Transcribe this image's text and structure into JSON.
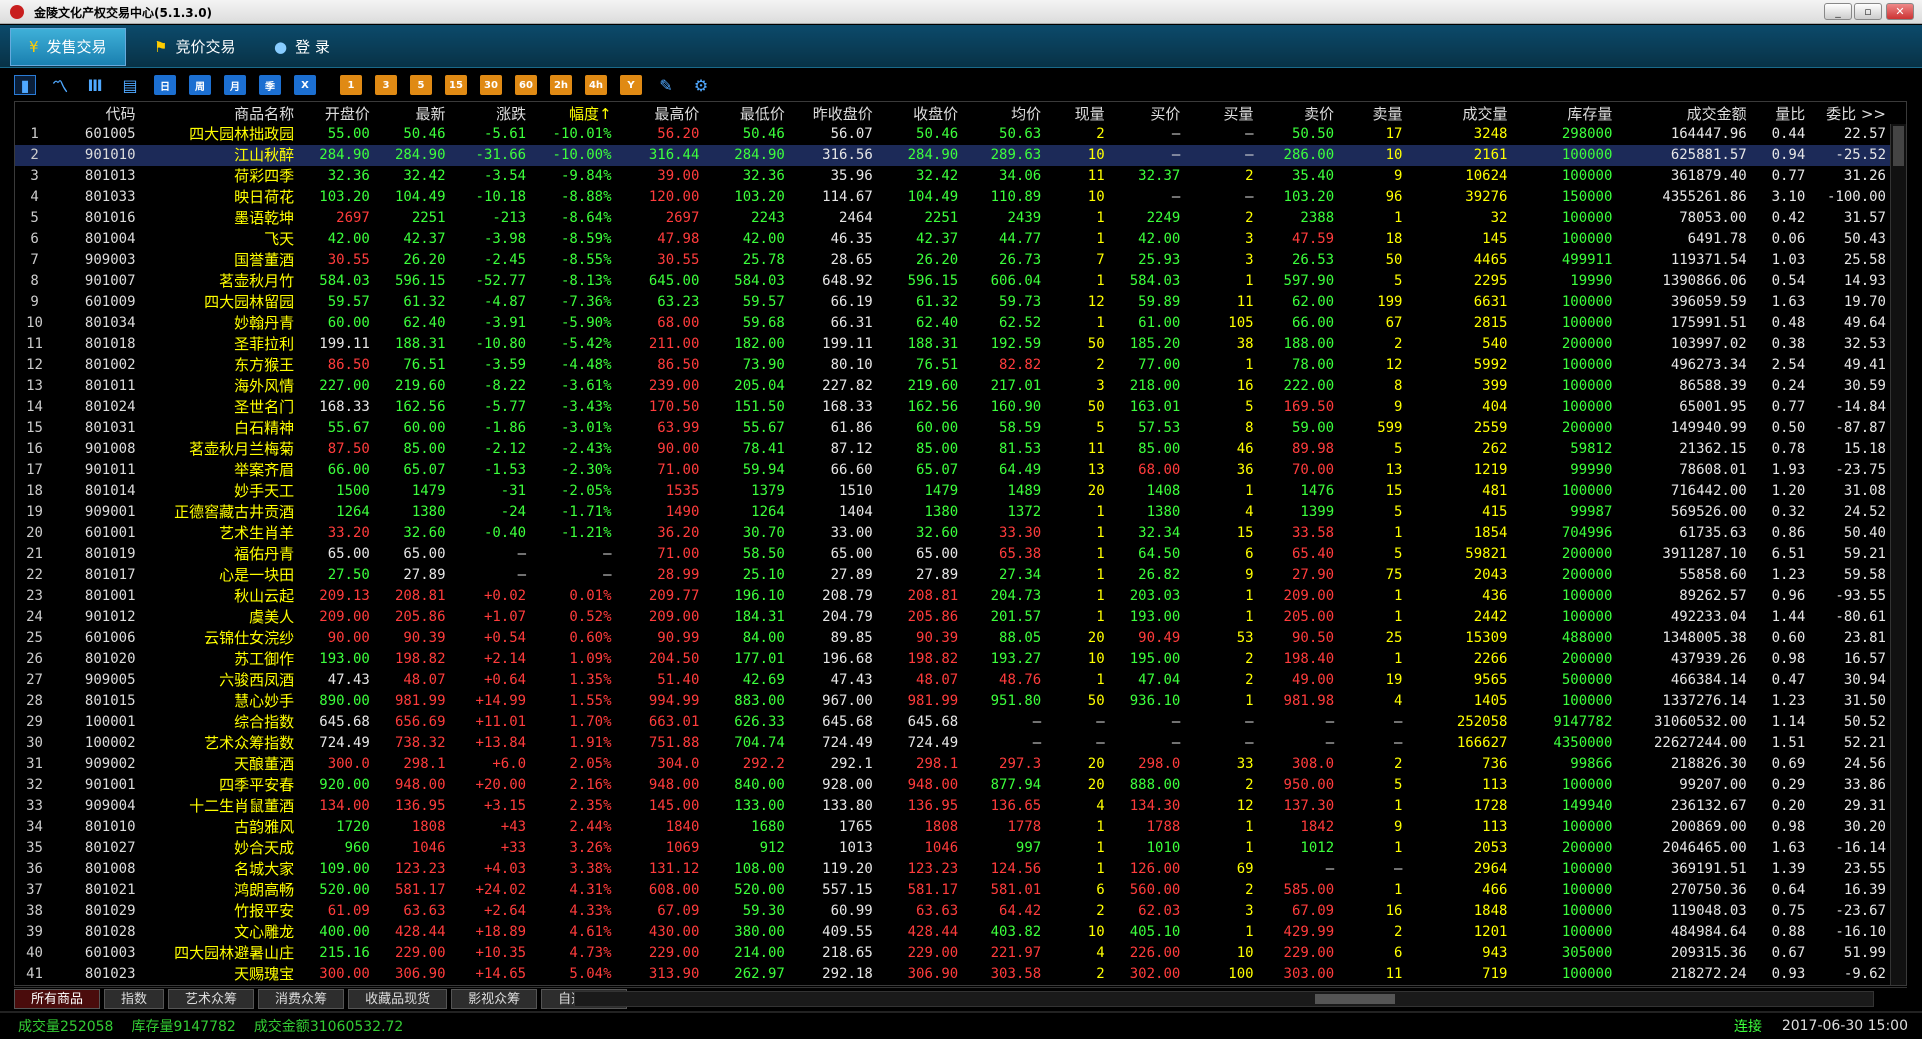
{
  "window": {
    "title": "金陵文化产权交易中心(5.1.3.0)",
    "min": "_",
    "max": "▫",
    "close": "✕"
  },
  "nav": {
    "tabs": [
      {
        "icon": "¥",
        "label": "发售交易",
        "active": true
      },
      {
        "icon": "⚑",
        "label": "竞价交易",
        "active": false
      },
      {
        "icon": "●",
        "label": "登  录",
        "active": false
      }
    ]
  },
  "toolbar": {
    "buttons": [
      {
        "icon": "bar-chart-icon",
        "glyph": "▮",
        "style": "ch sel"
      },
      {
        "icon": "line-chart-icon",
        "glyph": "〽",
        "style": "ch"
      },
      {
        "icon": "candlestick-icon",
        "glyph": "Ⅲ",
        "style": "ch"
      },
      {
        "icon": "calendar-icon",
        "glyph": "▤",
        "style": "ch"
      },
      {
        "label": "日",
        "style": "blue"
      },
      {
        "label": "周",
        "style": "blue"
      },
      {
        "label": "月",
        "style": "blue"
      },
      {
        "label": "季",
        "style": "blue"
      },
      {
        "label": "X",
        "style": "blue"
      },
      {
        "label": "1",
        "style": "orange"
      },
      {
        "label": "3",
        "style": "orange"
      },
      {
        "label": "5",
        "style": "orange"
      },
      {
        "label": "15",
        "style": "orange"
      },
      {
        "label": "30",
        "style": "orange"
      },
      {
        "label": "60",
        "style": "orange"
      },
      {
        "label": "2h",
        "style": "orange"
      },
      {
        "label": "4h",
        "style": "orange"
      },
      {
        "label": "Y",
        "style": "orange"
      },
      {
        "icon": "draw-tool-icon",
        "glyph": "✎",
        "style": "ch"
      },
      {
        "icon": "gear-icon",
        "glyph": "⚙",
        "style": "ch"
      }
    ]
  },
  "table": {
    "headers": [
      "",
      "代码",
      "商品名称",
      "开盘价",
      "最新",
      "涨跌",
      "幅度↑",
      "最高价",
      "最低价",
      "昨收盘价",
      "收盘价",
      "均价",
      "现量",
      "买价",
      "买量",
      "卖价",
      "卖量",
      "成交量",
      "库存量",
      "成交金额",
      "量比",
      "委比 >>"
    ],
    "rows": [
      [
        "1",
        "601005",
        "四大园林拙政园",
        "55.00",
        "50.46",
        "-5.61",
        "-10.01%",
        "56.20",
        "50.46",
        "56.07",
        "50.46",
        "50.63",
        "2",
        "—",
        "—",
        "50.50",
        "17",
        "3248",
        "298000",
        "164447.96",
        "0.44",
        "22.57"
      ],
      [
        "2",
        "901010",
        "江山秋醉",
        "284.90",
        "284.90",
        "-31.66",
        "-10.00%",
        "316.44",
        "284.90",
        "316.56",
        "284.90",
        "289.63",
        "10",
        "—",
        "—",
        "286.00",
        "10",
        "2161",
        "100000",
        "625881.57",
        "0.94",
        "-25.52"
      ],
      [
        "3",
        "801013",
        "荷彩四季",
        "32.36",
        "32.42",
        "-3.54",
        "-9.84%",
        "39.00",
        "32.36",
        "35.96",
        "32.42",
        "34.06",
        "11",
        "32.37",
        "2",
        "35.40",
        "9",
        "10624",
        "100000",
        "361879.40",
        "0.77",
        "31.26"
      ],
      [
        "4",
        "801033",
        "映日荷花",
        "103.20",
        "104.49",
        "-10.18",
        "-8.88%",
        "120.00",
        "103.20",
        "114.67",
        "104.49",
        "110.89",
        "10",
        "—",
        "—",
        "103.20",
        "96",
        "39276",
        "150000",
        "4355261.86",
        "3.10",
        "-100.00"
      ],
      [
        "5",
        "801016",
        "墨语乾坤",
        "2697",
        "2251",
        "-213",
        "-8.64%",
        "2697",
        "2243",
        "2464",
        "2251",
        "2439",
        "1",
        "2249",
        "2",
        "2388",
        "1",
        "32",
        "100000",
        "78053.00",
        "0.42",
        "31.57"
      ],
      [
        "6",
        "801004",
        "飞天",
        "42.00",
        "42.37",
        "-3.98",
        "-8.59%",
        "47.98",
        "42.00",
        "46.35",
        "42.37",
        "44.77",
        "1",
        "42.00",
        "3",
        "47.59",
        "18",
        "145",
        "100000",
        "6491.78",
        "0.06",
        "50.43"
      ],
      [
        "7",
        "909003",
        "国誉董酒",
        "30.55",
        "26.20",
        "-2.45",
        "-8.55%",
        "30.55",
        "25.78",
        "28.65",
        "26.20",
        "26.73",
        "7",
        "25.93",
        "3",
        "26.53",
        "50",
        "4465",
        "499911",
        "119371.54",
        "1.03",
        "25.58"
      ],
      [
        "8",
        "901007",
        "茗壶秋月竹",
        "584.03",
        "596.15",
        "-52.77",
        "-8.13%",
        "645.00",
        "584.03",
        "648.92",
        "596.15",
        "606.04",
        "1",
        "584.03",
        "1",
        "597.90",
        "5",
        "2295",
        "19990",
        "1390866.06",
        "0.54",
        "14.93"
      ],
      [
        "9",
        "601009",
        "四大园林留园",
        "59.57",
        "61.32",
        "-4.87",
        "-7.36%",
        "63.23",
        "59.57",
        "66.19",
        "61.32",
        "59.73",
        "12",
        "59.89",
        "11",
        "62.00",
        "199",
        "6631",
        "100000",
        "396059.59",
        "1.63",
        "19.70"
      ],
      [
        "10",
        "801034",
        "妙翰丹青",
        "60.00",
        "62.40",
        "-3.91",
        "-5.90%",
        "68.00",
        "59.68",
        "66.31",
        "62.40",
        "62.52",
        "1",
        "61.00",
        "105",
        "66.00",
        "67",
        "2815",
        "100000",
        "175991.51",
        "0.48",
        "49.64"
      ],
      [
        "11",
        "801018",
        "圣菲拉利",
        "199.11",
        "188.31",
        "-10.80",
        "-5.42%",
        "211.00",
        "182.00",
        "199.11",
        "188.31",
        "192.59",
        "50",
        "185.20",
        "38",
        "188.00",
        "2",
        "540",
        "200000",
        "103997.02",
        "0.38",
        "32.53"
      ],
      [
        "12",
        "801002",
        "东方猴王",
        "86.50",
        "76.51",
        "-3.59",
        "-4.48%",
        "86.50",
        "73.90",
        "80.10",
        "76.51",
        "82.82",
        "2",
        "77.00",
        "1",
        "78.00",
        "12",
        "5992",
        "100000",
        "496273.34",
        "2.54",
        "49.41"
      ],
      [
        "13",
        "801011",
        "海外风情",
        "227.00",
        "219.60",
        "-8.22",
        "-3.61%",
        "239.00",
        "205.04",
        "227.82",
        "219.60",
        "217.01",
        "3",
        "218.00",
        "16",
        "222.00",
        "8",
        "399",
        "100000",
        "86588.39",
        "0.24",
        "30.59"
      ],
      [
        "14",
        "801024",
        "圣世名门",
        "168.33",
        "162.56",
        "-5.77",
        "-3.43%",
        "170.50",
        "151.50",
        "168.33",
        "162.56",
        "160.90",
        "50",
        "163.01",
        "5",
        "169.50",
        "9",
        "404",
        "100000",
        "65001.95",
        "0.77",
        "-14.84"
      ],
      [
        "15",
        "801031",
        "白石精神",
        "55.67",
        "60.00",
        "-1.86",
        "-3.01%",
        "63.99",
        "55.67",
        "61.86",
        "60.00",
        "58.59",
        "5",
        "57.53",
        "8",
        "59.00",
        "599",
        "2559",
        "200000",
        "149940.99",
        "0.50",
        "-87.87"
      ],
      [
        "16",
        "901008",
        "茗壶秋月兰梅菊",
        "87.50",
        "85.00",
        "-2.12",
        "-2.43%",
        "90.00",
        "78.41",
        "87.12",
        "85.00",
        "81.53",
        "11",
        "85.00",
        "46",
        "89.98",
        "5",
        "262",
        "59812",
        "21362.15",
        "0.78",
        "15.18"
      ],
      [
        "17",
        "901011",
        "举案齐眉",
        "66.00",
        "65.07",
        "-1.53",
        "-2.30%",
        "71.00",
        "59.94",
        "66.60",
        "65.07",
        "64.49",
        "13",
        "68.00",
        "36",
        "70.00",
        "13",
        "1219",
        "99990",
        "78608.01",
        "1.93",
        "-23.75"
      ],
      [
        "18",
        "801014",
        "妙手天工",
        "1500",
        "1479",
        "-31",
        "-2.05%",
        "1535",
        "1379",
        "1510",
        "1479",
        "1489",
        "20",
        "1408",
        "1",
        "1476",
        "15",
        "481",
        "100000",
        "716442.00",
        "1.20",
        "31.08"
      ],
      [
        "19",
        "909001",
        "正德窖藏古井贡酒",
        "1264",
        "1380",
        "-24",
        "-1.71%",
        "1490",
        "1264",
        "1404",
        "1380",
        "1372",
        "1",
        "1380",
        "4",
        "1399",
        "5",
        "415",
        "99987",
        "569526.00",
        "0.32",
        "24.52"
      ],
      [
        "20",
        "601001",
        "艺术生肖羊",
        "33.20",
        "32.60",
        "-0.40",
        "-1.21%",
        "36.20",
        "30.70",
        "33.00",
        "32.60",
        "33.30",
        "1",
        "32.34",
        "15",
        "33.58",
        "1",
        "1854",
        "704996",
        "61735.63",
        "0.86",
        "50.40"
      ],
      [
        "21",
        "801019",
        "福佑丹青",
        "65.00",
        "65.00",
        "—",
        "—",
        "71.00",
        "58.50",
        "65.00",
        "65.00",
        "65.38",
        "1",
        "64.50",
        "6",
        "65.40",
        "5",
        "59821",
        "200000",
        "3911287.10",
        "6.51",
        "59.21"
      ],
      [
        "22",
        "801017",
        "心是一块田",
        "27.50",
        "27.89",
        "—",
        "—",
        "28.99",
        "25.10",
        "27.89",
        "27.89",
        "27.34",
        "1",
        "26.82",
        "9",
        "27.90",
        "75",
        "2043",
        "200000",
        "55858.60",
        "1.23",
        "59.58"
      ],
      [
        "23",
        "801001",
        "秋山云起",
        "209.13",
        "208.81",
        "+0.02",
        "0.01%",
        "209.77",
        "196.10",
        "208.79",
        "208.81",
        "204.73",
        "1",
        "203.03",
        "1",
        "209.00",
        "1",
        "436",
        "100000",
        "89262.57",
        "0.96",
        "-93.55"
      ],
      [
        "24",
        "901012",
        "虞美人",
        "209.00",
        "205.86",
        "+1.07",
        "0.52%",
        "209.00",
        "184.31",
        "204.79",
        "205.86",
        "201.57",
        "1",
        "193.00",
        "1",
        "205.00",
        "1",
        "2442",
        "100000",
        "492233.04",
        "1.44",
        "-80.61"
      ],
      [
        "25",
        "601006",
        "云锦仕女浣纱",
        "90.00",
        "90.39",
        "+0.54",
        "0.60%",
        "90.99",
        "84.00",
        "89.85",
        "90.39",
        "88.05",
        "20",
        "90.49",
        "53",
        "90.50",
        "25",
        "15309",
        "488000",
        "1348005.38",
        "0.60",
        "23.81"
      ],
      [
        "26",
        "801020",
        "苏工御作",
        "193.00",
        "198.82",
        "+2.14",
        "1.09%",
        "204.50",
        "177.01",
        "196.68",
        "198.82",
        "193.27",
        "10",
        "195.00",
        "2",
        "198.40",
        "1",
        "2266",
        "200000",
        "437939.26",
        "0.98",
        "16.57"
      ],
      [
        "27",
        "909005",
        "六骏西凤酒",
        "47.43",
        "48.07",
        "+0.64",
        "1.35%",
        "51.40",
        "42.69",
        "47.43",
        "48.07",
        "48.76",
        "1",
        "47.04",
        "2",
        "49.00",
        "19",
        "9565",
        "500000",
        "466384.14",
        "0.47",
        "30.94"
      ],
      [
        "28",
        "801015",
        "慧心妙手",
        "890.00",
        "981.99",
        "+14.99",
        "1.55%",
        "994.99",
        "883.00",
        "967.00",
        "981.99",
        "951.80",
        "50",
        "936.10",
        "1",
        "981.98",
        "4",
        "1405",
        "100000",
        "1337276.14",
        "1.23",
        "31.50"
      ],
      [
        "29",
        "100001",
        "综合指数",
        "645.68",
        "656.69",
        "+11.01",
        "1.70%",
        "663.01",
        "626.33",
        "645.68",
        "645.68",
        "—",
        "—",
        "—",
        "—",
        "—",
        "—",
        "252058",
        "9147782",
        "31060532.00",
        "1.14",
        "50.52"
      ],
      [
        "30",
        "100002",
        "艺术众筹指数",
        "724.49",
        "738.32",
        "+13.84",
        "1.91%",
        "751.88",
        "704.74",
        "724.49",
        "724.49",
        "—",
        "—",
        "—",
        "—",
        "—",
        "—",
        "166627",
        "4350000",
        "22627244.00",
        "1.51",
        "52.21"
      ],
      [
        "31",
        "909002",
        "天酿董酒",
        "300.0",
        "298.1",
        "+6.0",
        "2.05%",
        "304.0",
        "292.2",
        "292.1",
        "298.1",
        "297.3",
        "20",
        "298.0",
        "33",
        "308.0",
        "2",
        "736",
        "99866",
        "218826.30",
        "0.69",
        "24.56"
      ],
      [
        "32",
        "901001",
        "四季平安春",
        "920.00",
        "948.00",
        "+20.00",
        "2.16%",
        "948.00",
        "840.00",
        "928.00",
        "948.00",
        "877.94",
        "20",
        "888.00",
        "2",
        "950.00",
        "5",
        "113",
        "100000",
        "99207.00",
        "0.29",
        "33.86"
      ],
      [
        "33",
        "909004",
        "十二生肖鼠董酒",
        "134.00",
        "136.95",
        "+3.15",
        "2.35%",
        "145.00",
        "133.00",
        "133.80",
        "136.95",
        "136.65",
        "4",
        "134.30",
        "12",
        "137.30",
        "1",
        "1728",
        "149940",
        "236132.67",
        "0.20",
        "29.31"
      ],
      [
        "34",
        "801010",
        "古韵雅风",
        "1720",
        "1808",
        "+43",
        "2.44%",
        "1840",
        "1680",
        "1765",
        "1808",
        "1778",
        "1",
        "1788",
        "1",
        "1842",
        "9",
        "113",
        "100000",
        "200869.00",
        "0.98",
        "30.20"
      ],
      [
        "35",
        "801027",
        "妙合天成",
        "960",
        "1046",
        "+33",
        "3.26%",
        "1069",
        "912",
        "1013",
        "1046",
        "997",
        "1",
        "1010",
        "1",
        "1012",
        "1",
        "2053",
        "200000",
        "2046465.00",
        "1.63",
        "-16.14"
      ],
      [
        "36",
        "801008",
        "名城大家",
        "109.00",
        "123.23",
        "+4.03",
        "3.38%",
        "131.12",
        "108.00",
        "119.20",
        "123.23",
        "124.56",
        "1",
        "126.00",
        "69",
        "—",
        "—",
        "2964",
        "100000",
        "369191.51",
        "1.39",
        "23.55"
      ],
      [
        "37",
        "801021",
        "鸿朗高畅",
        "520.00",
        "581.17",
        "+24.02",
        "4.31%",
        "608.00",
        "520.00",
        "557.15",
        "581.17",
        "581.01",
        "6",
        "560.00",
        "2",
        "585.00",
        "1",
        "466",
        "100000",
        "270750.36",
        "0.64",
        "16.39"
      ],
      [
        "38",
        "801029",
        "竹报平安",
        "61.09",
        "63.63",
        "+2.64",
        "4.33%",
        "67.09",
        "59.30",
        "60.99",
        "63.63",
        "64.42",
        "2",
        "62.03",
        "3",
        "67.09",
        "16",
        "1848",
        "100000",
        "119048.03",
        "0.75",
        "-23.67"
      ],
      [
        "39",
        "801028",
        "文心雕龙",
        "400.00",
        "428.44",
        "+18.89",
        "4.61%",
        "430.00",
        "380.00",
        "409.55",
        "428.44",
        "403.82",
        "10",
        "405.10",
        "1",
        "429.99",
        "2",
        "1201",
        "100000",
        "484984.64",
        "0.88",
        "-16.10"
      ],
      [
        "40",
        "601003",
        "四大园林避暑山庄",
        "215.16",
        "229.00",
        "+10.35",
        "4.73%",
        "229.00",
        "214.00",
        "218.65",
        "229.00",
        "221.97",
        "4",
        "226.00",
        "10",
        "229.00",
        "6",
        "943",
        "305000",
        "209315.36",
        "0.67",
        "51.99"
      ],
      [
        "41",
        "801023",
        "天赐瑰宝",
        "300.00",
        "306.90",
        "+14.65",
        "5.04%",
        "313.90",
        "262.97",
        "292.18",
        "306.90",
        "303.58",
        "2",
        "302.00",
        "100",
        "303.00",
        "11",
        "719",
        "100000",
        "218272.24",
        "0.93",
        "-9.62"
      ]
    ]
  },
  "bottom_tabs": [
    "所有商品",
    "指数",
    "艺术众筹",
    "消费众筹",
    "收藏品现货",
    "影视众筹",
    "自选商品"
  ],
  "status": {
    "volume_label": "成交量",
    "volume": "252058",
    "stock_label": "库存量",
    "stock": "9147782",
    "amount_label": "成交金额",
    "amount": "31060532.72",
    "connection": "连接",
    "datetime": "2017-06-30 15:00"
  },
  "colors": {
    "up": "#ff3c3c",
    "down": "#3cff3c",
    "flat": "#e6e6e6",
    "name": "#ffff00",
    "selected_row": "#1c2a58"
  }
}
